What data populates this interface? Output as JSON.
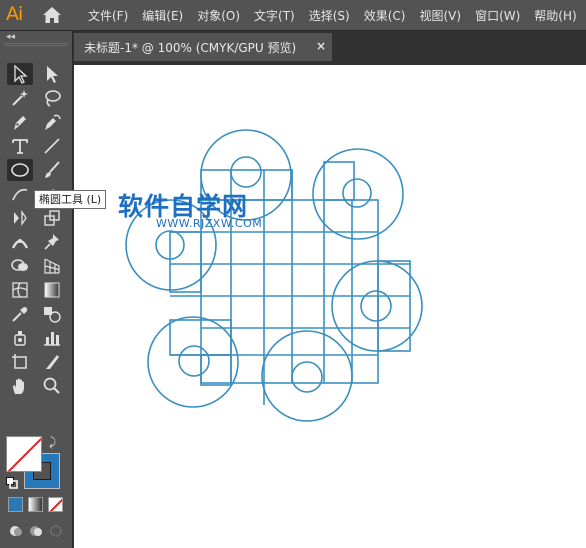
{
  "app": {
    "logo": "Ai",
    "accent_color": "#ff9a00",
    "home_icon": "home-icon"
  },
  "menu": {
    "items": [
      "文件(F)",
      "编辑(E)",
      "对象(O)",
      "文字(T)",
      "选择(S)",
      "效果(C)",
      "视图(V)",
      "窗口(W)",
      "帮助(H)"
    ]
  },
  "panel": {
    "collapse_label": "◂◂",
    "tools": [
      "selection-tool",
      "direct-selection-tool",
      "magic-wand-tool",
      "lasso-tool",
      "pen-tool",
      "curvature-tool",
      "type-tool",
      "line-segment-tool",
      "ellipse-tool",
      "paintbrush-tool",
      "shaper-tool",
      "eraser-tool",
      "rotate-tool",
      "scale-tool",
      "width-tool",
      "puppet-warp-tool",
      "shape-builder-tool",
      "perspective-grid-tool",
      "mesh-tool",
      "gradient-tool",
      "eyedropper-tool",
      "blend-tool",
      "symbol-sprayer-tool",
      "column-graph-tool",
      "artboard-tool",
      "slice-tool",
      "hand-tool",
      "zoom-tool"
    ],
    "active_tool": "ellipse-tool",
    "fill": {
      "color": "#ffffff",
      "state": "none"
    },
    "stroke": {
      "color": "#2778b8"
    }
  },
  "tooltip": {
    "text": "椭圆工具 (L)"
  },
  "document": {
    "tab_title": "未标题-1* @ 100% (CMYK/GPU 预览)",
    "close_label": "×"
  },
  "artwork": {
    "stroke_color": "#3a8fbf",
    "description_shape": "chinese-knot-grid-with-circles"
  },
  "watermark": {
    "title": "软件自学网",
    "url": "WWW.RJZXW.COM",
    "color": "#1f6fc0"
  }
}
